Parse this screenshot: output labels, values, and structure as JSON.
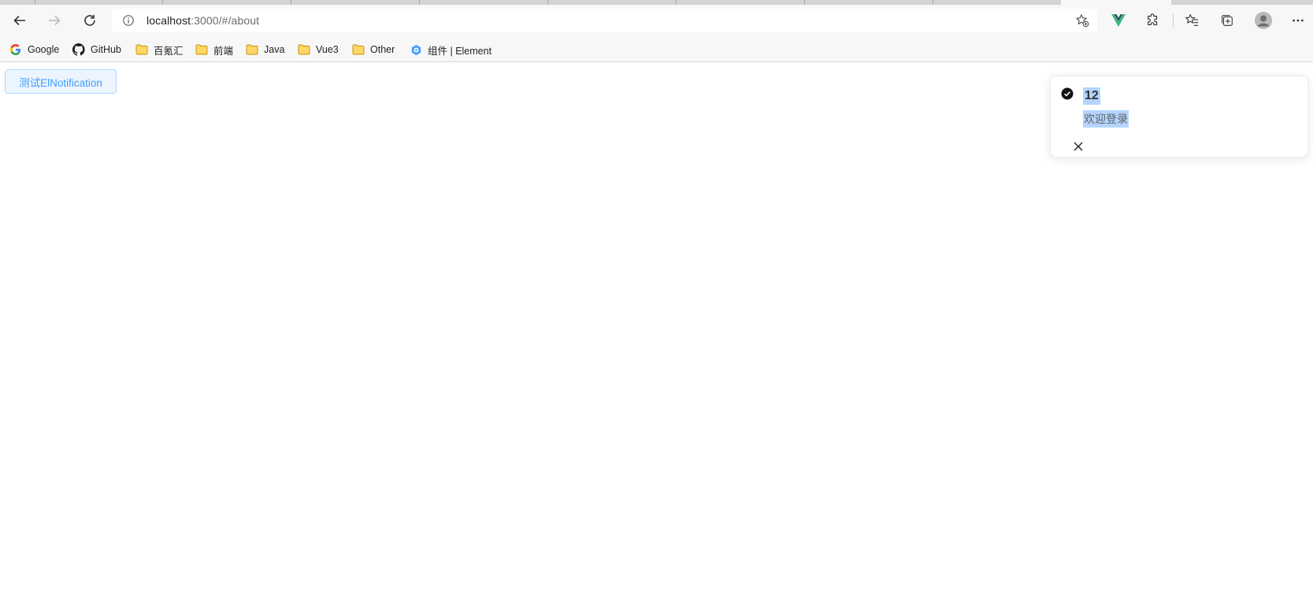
{
  "browser": {
    "url_host": "localhost",
    "url_rest": ":3000/#/about",
    "icons": {
      "back": "arrow-left-icon",
      "forward": "arrow-right-icon",
      "reload": "reload-icon",
      "site_info": "info-icon",
      "add_favorite": "star-plus-icon",
      "vue_devtools": "vue-logo-icon",
      "extensions": "puzzle-icon",
      "favorites": "favorites-icon",
      "collections": "collections-icon",
      "profile": "avatar-icon",
      "more": "more-icon"
    }
  },
  "bookmarks": [
    {
      "label": "Google",
      "icon": "google-icon"
    },
    {
      "label": "GitHub",
      "icon": "github-icon"
    },
    {
      "label": "百氪汇",
      "icon": "folder-icon"
    },
    {
      "label": "前端",
      "icon": "folder-icon"
    },
    {
      "label": "Java",
      "icon": "folder-icon"
    },
    {
      "label": "Vue3",
      "icon": "folder-icon"
    },
    {
      "label": "Other",
      "icon": "folder-icon"
    },
    {
      "label": "组件 | Element",
      "icon": "element-logo-icon"
    }
  ],
  "page": {
    "test_button_label": "测试ElNotification",
    "notification": {
      "title": "12",
      "message": "欢迎登录",
      "type": "success",
      "icon": "check-circle-icon",
      "close_icon": "close-icon"
    }
  },
  "colors": {
    "button_text": "#409eff",
    "button_bg": "#ecf5ff",
    "selection": "#b4d5fe"
  }
}
